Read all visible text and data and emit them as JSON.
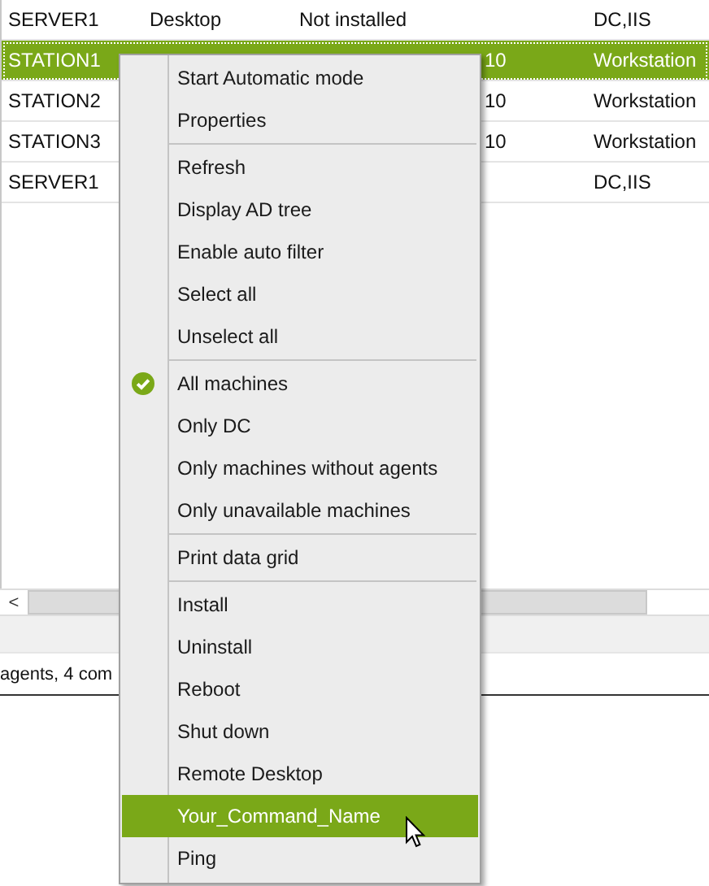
{
  "table": {
    "rows": [
      {
        "selected": false,
        "column_1": "SERVER1",
        "column_2": "Desktop",
        "column_3": "Not installed",
        "column_5": "DC,IIS"
      },
      {
        "selected": true,
        "column_1": "STATION1",
        "column_4": "10",
        "column_5": "Workstation"
      },
      {
        "selected": false,
        "column_1": "STATION2",
        "column_4": "10",
        "column_5": "Workstation"
      },
      {
        "selected": false,
        "column_1": "STATION3",
        "column_4": "10",
        "column_5": "Workstation"
      },
      {
        "selected": false,
        "column_1": "SERVER1",
        "column_5": "DC,IIS"
      }
    ]
  },
  "scrollbar": {
    "left_button": "<"
  },
  "status_bar": {
    "text": "agents, 4 com"
  },
  "context_menu": {
    "items": [
      {
        "kind": "item",
        "label": "Start Automatic mode",
        "checked": false,
        "selected": false
      },
      {
        "kind": "item",
        "label": "Properties",
        "checked": false,
        "selected": false
      },
      {
        "kind": "separator"
      },
      {
        "kind": "item",
        "label": "Refresh",
        "checked": false,
        "selected": false
      },
      {
        "kind": "item",
        "label": "Display AD tree",
        "checked": false,
        "selected": false
      },
      {
        "kind": "item",
        "label": "Enable auto filter",
        "checked": false,
        "selected": false
      },
      {
        "kind": "item",
        "label": "Select all",
        "checked": false,
        "selected": false
      },
      {
        "kind": "item",
        "label": "Unselect all",
        "checked": false,
        "selected": false
      },
      {
        "kind": "separator"
      },
      {
        "kind": "item",
        "label": "All machines",
        "checked": true,
        "selected": false
      },
      {
        "kind": "item",
        "label": "Only DC",
        "checked": false,
        "selected": false
      },
      {
        "kind": "item",
        "label": "Only machines without agents",
        "checked": false,
        "selected": false
      },
      {
        "kind": "item",
        "label": "Only unavailable machines",
        "checked": false,
        "selected": false
      },
      {
        "kind": "separator"
      },
      {
        "kind": "item",
        "label": "Print data grid",
        "checked": false,
        "selected": false
      },
      {
        "kind": "separator"
      },
      {
        "kind": "item",
        "label": "Install",
        "checked": false,
        "selected": false
      },
      {
        "kind": "item",
        "label": "Uninstall",
        "checked": false,
        "selected": false
      },
      {
        "kind": "item",
        "label": "Reboot",
        "checked": false,
        "selected": false
      },
      {
        "kind": "item",
        "label": "Shut down",
        "checked": false,
        "selected": false
      },
      {
        "kind": "item",
        "label": "Remote Desktop",
        "checked": false,
        "selected": false
      },
      {
        "kind": "item",
        "label": "Your_Command_Name",
        "checked": false,
        "selected": true
      },
      {
        "kind": "item",
        "label": "Ping",
        "checked": false,
        "selected": false
      }
    ]
  }
}
